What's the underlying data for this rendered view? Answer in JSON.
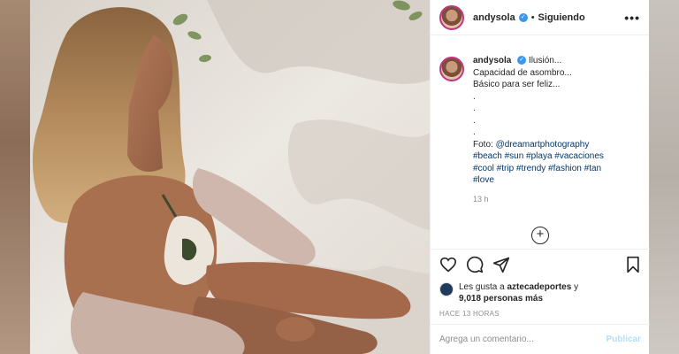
{
  "post": {
    "username": "andysola",
    "follow_state": "Siguiendo",
    "separator": "•",
    "verified_mark": "✓",
    "more_icon": "•••",
    "caption": {
      "first_line": "Ilusión...",
      "lines": [
        "Capacidad de asombro...",
        "Básico para ser feliz...",
        ".",
        ".",
        ".",
        "."
      ],
      "credit_prefix": "Foto: ",
      "credit_handle": "@dreamartphotography",
      "hashtag_lines": [
        "#beach #sun #playa #vacaciones",
        "#cool #trip #trendy #fashion #tan",
        "#love"
      ]
    },
    "caption_time": "13 h",
    "add_symbol": "+",
    "likes": {
      "prefix": "Les gusta a ",
      "first_user": "aztecadeportes",
      "middle": " y",
      "others": "9,018 personas más"
    },
    "posted_ago": "HACE 13 HORAS",
    "comment_placeholder": "Agrega un comentario...",
    "publish_label": "Publicar"
  },
  "colors": {
    "accent_link": "#00376b",
    "verified": "#3897f0",
    "publish_disabled": "#b2dffc",
    "story_ring": "#c13584"
  },
  "icons": [
    "more-icon",
    "heart-icon",
    "comment-icon",
    "share-icon",
    "bookmark-icon",
    "add-circle-icon",
    "verified-icon"
  ]
}
